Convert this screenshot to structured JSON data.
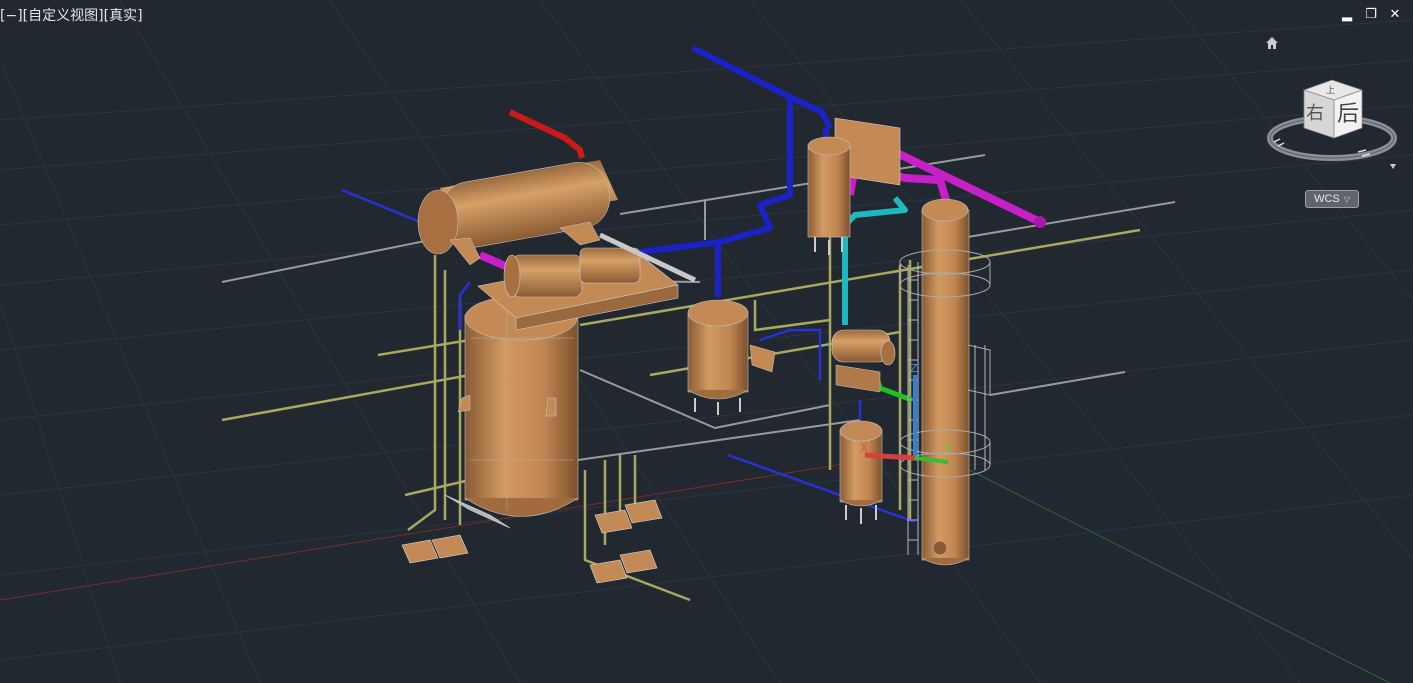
{
  "viewport": {
    "label_parts": [
      "[",
      "−",
      "][",
      "自定义视图",
      "][",
      "真实",
      "]"
    ],
    "background": "#212830"
  },
  "window_controls": {
    "minimize": "▂",
    "restore": "❐",
    "close": "✕"
  },
  "viewcube": {
    "face_front": "后",
    "face_side": "右",
    "face_top": "上",
    "home_icon": "home-icon",
    "menu_icon": "chevron-down-icon"
  },
  "coordinate_system": {
    "label": "WCS",
    "dropdown_icon": "▽"
  },
  "scene": {
    "equipment_color": "#c48a55",
    "pipe_colors": {
      "blue": "#1a22c8",
      "magenta": "#c820c8",
      "red": "#cc1a1a",
      "cyan": "#20b8c0",
      "green": "#20c020",
      "olive": "#a8a860",
      "gray": "#9a9a9a"
    },
    "ucs_axes": {
      "x": "#d84040",
      "y": "#30c030",
      "z": "#3080e0"
    }
  }
}
